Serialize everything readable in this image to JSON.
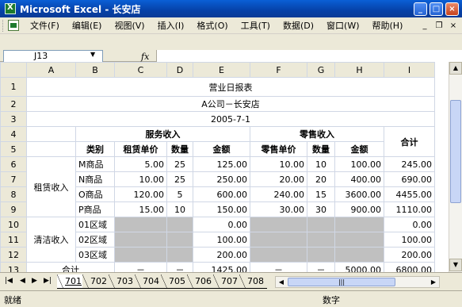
{
  "window": {
    "title": "Microsoft Excel - 长安店",
    "app_icon": "excel-icon"
  },
  "menu": {
    "items": [
      "文件(F)",
      "编辑(E)",
      "视图(V)",
      "插入(I)",
      "格式(O)",
      "工具(T)",
      "数据(D)",
      "窗口(W)",
      "帮助(H)"
    ],
    "mdi_min": "_",
    "mdi_restore": "❐",
    "mdi_close": "×"
  },
  "formula": {
    "name_box": "J13",
    "fx": "fx",
    "value": ""
  },
  "columns": [
    "A",
    "B",
    "C",
    "D",
    "E",
    "F",
    "G",
    "H",
    "I"
  ],
  "rows": [
    "1",
    "2",
    "3",
    "4",
    "5",
    "6",
    "7",
    "8",
    "9",
    "10",
    "11",
    "12",
    "13"
  ],
  "sheet": {
    "title": "营业日报表",
    "company": "A公司－长安店",
    "date": "2005-7-1",
    "service_header": "服务收入",
    "retail_header": "零售收入",
    "total_header": "合计",
    "sub_headers": {
      "category": "类别",
      "rent_price": "租赁单价",
      "qty": "数量",
      "amount": "金额",
      "retail_price": "零售单价",
      "qty2": "数量",
      "amount2": "金额"
    },
    "rental_group": "租赁收入",
    "rental_rows": [
      {
        "cat": "M商品",
        "price": "5.00",
        "qty": "25",
        "amount": "125.00",
        "rprice": "10.00",
        "rqty": "10",
        "ramount": "100.00",
        "total": "245.00"
      },
      {
        "cat": "N商品",
        "price": "10.00",
        "qty": "25",
        "amount": "250.00",
        "rprice": "20.00",
        "rqty": "20",
        "ramount": "400.00",
        "total": "690.00"
      },
      {
        "cat": "O商品",
        "price": "120.00",
        "qty": "5",
        "amount": "600.00",
        "rprice": "240.00",
        "rqty": "15",
        "ramount": "3600.00",
        "total": "4455.00"
      },
      {
        "cat": "P商品",
        "price": "15.00",
        "qty": "10",
        "amount": "150.00",
        "rprice": "30.00",
        "rqty": "30",
        "ramount": "900.00",
        "total": "1110.00"
      }
    ],
    "cleaning_group": "清洁收入",
    "cleaning_rows": [
      {
        "cat": "01区域",
        "amount": "0.00",
        "total": "0.00"
      },
      {
        "cat": "02区域",
        "amount": "100.00",
        "total": "100.00"
      },
      {
        "cat": "03区域",
        "amount": "200.00",
        "total": "200.00"
      }
    ],
    "sum_row": {
      "label": "合计",
      "c": "－",
      "d": "－",
      "e": "1425.00",
      "f": "－",
      "g": "－",
      "h": "5000.00",
      "i": "6800.00"
    }
  },
  "tabs": [
    "701",
    "702",
    "703",
    "704",
    "705",
    "706",
    "707",
    "708"
  ],
  "active_tab": "701",
  "status": {
    "ready": "就绪",
    "mode": "数字"
  }
}
